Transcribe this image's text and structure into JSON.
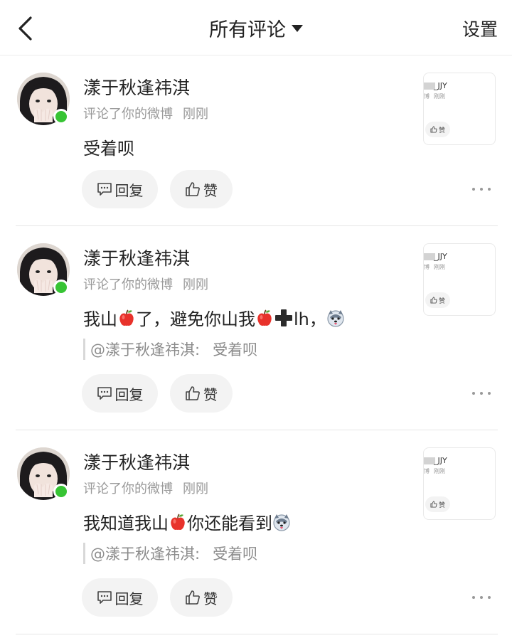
{
  "header": {
    "back_icon": "chevron-left-icon",
    "title": "所有评论",
    "dropdown_icon": "caret-down-icon",
    "settings_label": "设置"
  },
  "comments": [
    {
      "user_name": "漾于秋逢祎淇",
      "action": "评论了你的微博",
      "time": "刚刚",
      "content": "受着呗",
      "quote": null,
      "online": true,
      "reply_label": "回复",
      "like_label": "赞",
      "thumbnail": {
        "user": "JJY",
        "source": "博",
        "time": "刚刚",
        "like_label": "赞"
      }
    },
    {
      "user_name": "漾于秋逢祎淇",
      "action": "评论了你的微博",
      "time": "刚刚",
      "content_parts": [
        "我山",
        "了，避免你山我",
        "lh，"
      ],
      "content_icons": [
        "apple-emoji",
        "plus-emoji",
        "dog-emoji"
      ],
      "quote": {
        "mention": "@漾于秋逢祎淇:",
        "text": "受着呗"
      },
      "online": true,
      "reply_label": "回复",
      "like_label": "赞",
      "thumbnail": {
        "user": "JJY",
        "source": "博",
        "time": "刚刚",
        "like_label": "赞"
      }
    },
    {
      "user_name": "漾于秋逢祎淇",
      "action": "评论了你的微博",
      "time": "刚刚",
      "content_parts": [
        "我知道我山",
        "你还能看到"
      ],
      "content_icons": [
        "apple-emoji",
        "dog-emoji"
      ],
      "quote": {
        "mention": "@漾于秋逢祎淇:",
        "text": "受着呗"
      },
      "online": true,
      "reply_label": "回复",
      "like_label": "赞",
      "thumbnail": {
        "user": "JJY",
        "source": "博",
        "time": "刚刚",
        "like_label": "赞"
      }
    }
  ],
  "colors": {
    "online_dot": "#37c434",
    "button_bg": "#f3f3f3",
    "meta_text": "#9a9a9a",
    "divider": "#e6e6e6"
  }
}
